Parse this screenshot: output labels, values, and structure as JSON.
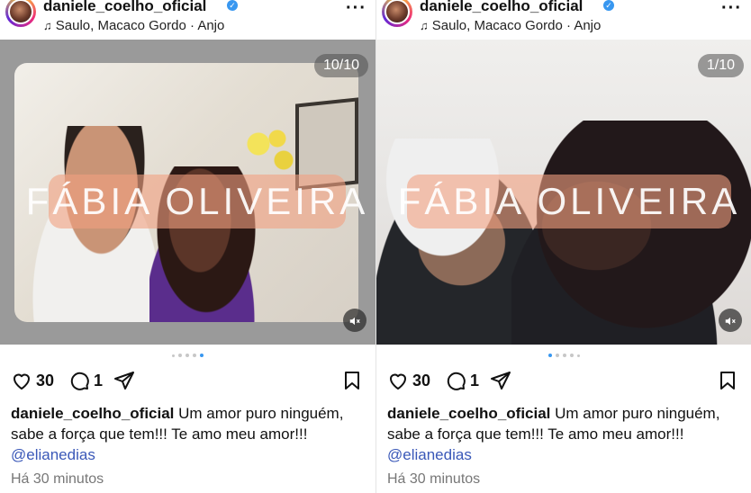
{
  "posts": [
    {
      "username": "daniele_coelho_oficial",
      "music": "Saulo, Macaco Gordo · Anjo",
      "counter": "10/10",
      "watermark": "FÁBIA OLIVEIRA",
      "likes": "30",
      "comments": "1",
      "caption_user": "daniele_coelho_oficial",
      "caption_text": "Um amor puro ninguém, sabe a força que tem!!! Te amo meu amor!!!",
      "mention": "@elianedias",
      "time": "Há 30 minutos"
    },
    {
      "username": "daniele_coelho_oficial",
      "music": "Saulo, Macaco Gordo · Anjo",
      "counter": "1/10",
      "watermark": "FÁBIA OLIVEIRA",
      "likes": "30",
      "comments": "1",
      "caption_user": "daniele_coelho_oficial",
      "caption_text": "Um amor puro ninguém, sabe a força que tem!!! Te amo meu amor!!!",
      "mention": "@elianedias",
      "time": "Há 30 minutos"
    }
  ],
  "icons": {
    "like": "heart-icon",
    "comment": "comment-icon",
    "share": "share-icon",
    "save": "bookmark-icon",
    "mute": "muted-speaker-icon",
    "more": "more-options-icon",
    "verified": "verified-badge-icon",
    "music": "music-note-icon"
  },
  "colors": {
    "verified": "#3897f0",
    "mention": "#3a58b8",
    "active_dot": "#3897f0",
    "watermark_bg": "#f1a080"
  }
}
